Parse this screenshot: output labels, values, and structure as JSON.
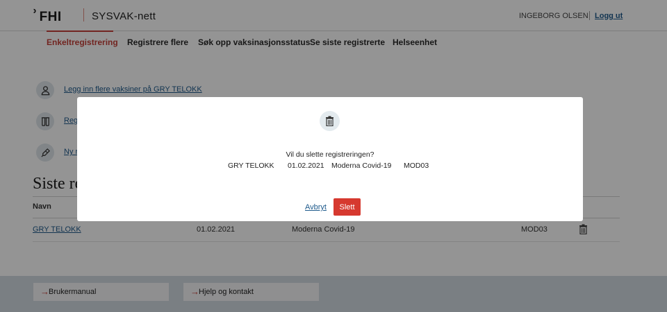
{
  "header": {
    "logo_text": "FHI",
    "app_name": "SYSVAK-nett",
    "user_name": "INGEBORG OLSEN",
    "logout_label": "Logg ut"
  },
  "nav": {
    "tabs": [
      {
        "label": "Enkeltregistrering",
        "active": true
      },
      {
        "label": "Registrere flere",
        "active": false
      },
      {
        "label": "Søk opp vaksinasjonsstatus",
        "active": false
      },
      {
        "label": "Se siste registrerte",
        "active": false
      },
      {
        "label": "Helseenhet",
        "active": false
      }
    ]
  },
  "actions": [
    {
      "icon": "person-icon",
      "label": "Legg inn flere vaksiner på GRY TELOKK"
    },
    {
      "icon": "vials-icon",
      "label": "Reg"
    },
    {
      "icon": "syringe-icon",
      "label": "Ny r"
    }
  ],
  "recent": {
    "title": "Siste re",
    "column_name": "Navn",
    "rows": [
      {
        "name": "GRY TELOKK",
        "date": "01.02.2021",
        "vaccine": "Moderna Covid-19",
        "code": "MOD03"
      }
    ]
  },
  "footer": {
    "links": [
      {
        "label": "Brukermanual"
      },
      {
        "label": "Hjelp og kontakt"
      }
    ]
  },
  "modal": {
    "icon": "trash-icon",
    "question": "Vil du slette registreringen?",
    "name": "GRY TELOKK",
    "date": "01.02.2021",
    "vaccine": "Moderna Covid-19",
    "code": "MOD03",
    "cancel_label": "Avbryt",
    "delete_label": "Slett"
  },
  "colors": {
    "accent_red": "#c4413a",
    "link_blue": "#1f5b8c",
    "delete_button": "#d6392f",
    "footer_bg": "#d2dbe2"
  }
}
